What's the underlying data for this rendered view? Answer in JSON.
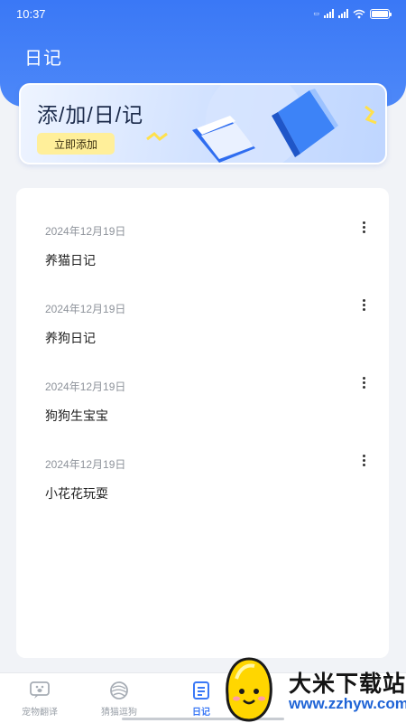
{
  "status_bar": {
    "time": "10:37"
  },
  "header": {
    "title": "日记"
  },
  "banner": {
    "title": "添/加/日/记",
    "button_label": "立即添加"
  },
  "diary_entries": [
    {
      "date": "2024年12月19日",
      "title": "养猫日记"
    },
    {
      "date": "2024年12月19日",
      "title": "养狗日记"
    },
    {
      "date": "2024年12月19日",
      "title": "狗狗生宝宝"
    },
    {
      "date": "2024年12月19日",
      "title": "小花花玩耍"
    }
  ],
  "tabbar": {
    "tabs": [
      {
        "label": "宠物翻译",
        "icon": "pet-translate-icon",
        "active": false
      },
      {
        "label": "猜猫逗狗",
        "icon": "yarn-ball-icon",
        "active": false
      },
      {
        "label": "日记",
        "icon": "diary-icon",
        "active": true
      }
    ]
  },
  "watermark": {
    "brand": "大米下载站",
    "url": "www.zzhyw.com"
  },
  "colors": {
    "primary": "#3a78f6",
    "button_yellow": "#ffef9a",
    "background": "#f1f3f7"
  }
}
